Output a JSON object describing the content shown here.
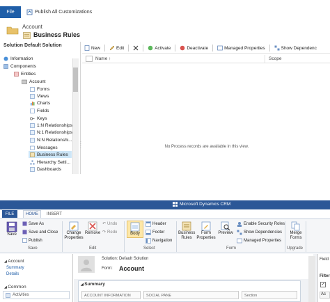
{
  "top": {
    "file_button": "File",
    "publish_all": "Publish All Customizations",
    "breadcrumb": "Account",
    "page_title": "Business Rules",
    "solution_header": "Solution Default Solution",
    "tree": [
      {
        "label": "Information"
      },
      {
        "label": "Components"
      },
      {
        "label": "Entities"
      },
      {
        "label": "Account"
      },
      {
        "label": "Forms"
      },
      {
        "label": "Views"
      },
      {
        "label": "Charts"
      },
      {
        "label": "Fields"
      },
      {
        "label": "Keys"
      },
      {
        "label": "1:N Relationships"
      },
      {
        "label": "N:1 Relationships"
      },
      {
        "label": "N:N Relationshi..."
      },
      {
        "label": "Messages"
      },
      {
        "label": "Business Rules",
        "selected": true
      },
      {
        "label": "Hierarchy Setti..."
      },
      {
        "label": "Dashboards"
      }
    ],
    "toolbar": {
      "new": "New",
      "edit": "Edit",
      "activate": "Activate",
      "deactivate": "Deactivate",
      "managed_properties": "Managed Properties",
      "show_dependencies": "Show Dependenc"
    },
    "grid": {
      "col_name": "Name ↑",
      "col_scope": "Scope",
      "empty_message": "No Process records are available in this view."
    }
  },
  "bottom": {
    "app_title": "Microsoft Dynamics CRM",
    "tabs": {
      "file": "FILE",
      "home": "HOME",
      "insert": "INSERT"
    },
    "ribbon": {
      "save": "Save",
      "save_as": "Save As",
      "save_and_close": "Save and Close",
      "publish": "Publish",
      "change_properties": "Change Properties",
      "remove": "Remove",
      "undo": "Undo",
      "redo": "Redo",
      "body": "Body",
      "header": "Header",
      "footer": "Footer",
      "navigation": "Navigation",
      "business_rules": "Business Rules",
      "form_properties": "Form Properties",
      "preview": "Preview",
      "enable_security_roles": "Enable Security Roles",
      "show_dependencies": "Show Dependencies",
      "managed_properties": "Managed Properties",
      "merge_forms": "Merge Forms",
      "group_save": "Save",
      "group_edit": "Edit",
      "group_select": "Select",
      "group_form": "Form",
      "group_upgrade": "Upgrade"
    },
    "nav": {
      "account": "Account",
      "summary": "Summary",
      "details": "Details",
      "common": "Common",
      "activities": "Activities"
    },
    "form": {
      "solution_line": "Solution: Default Solution",
      "form_label": "Form:",
      "form_name": "Account",
      "section_title": "Summary",
      "cells": [
        "ACCOUNT INFORMATION",
        "SOCIAL PANE",
        "Section"
      ]
    },
    "right_pane": {
      "label1": "Field",
      "label2": "Filter",
      "label3": "Ac"
    }
  }
}
